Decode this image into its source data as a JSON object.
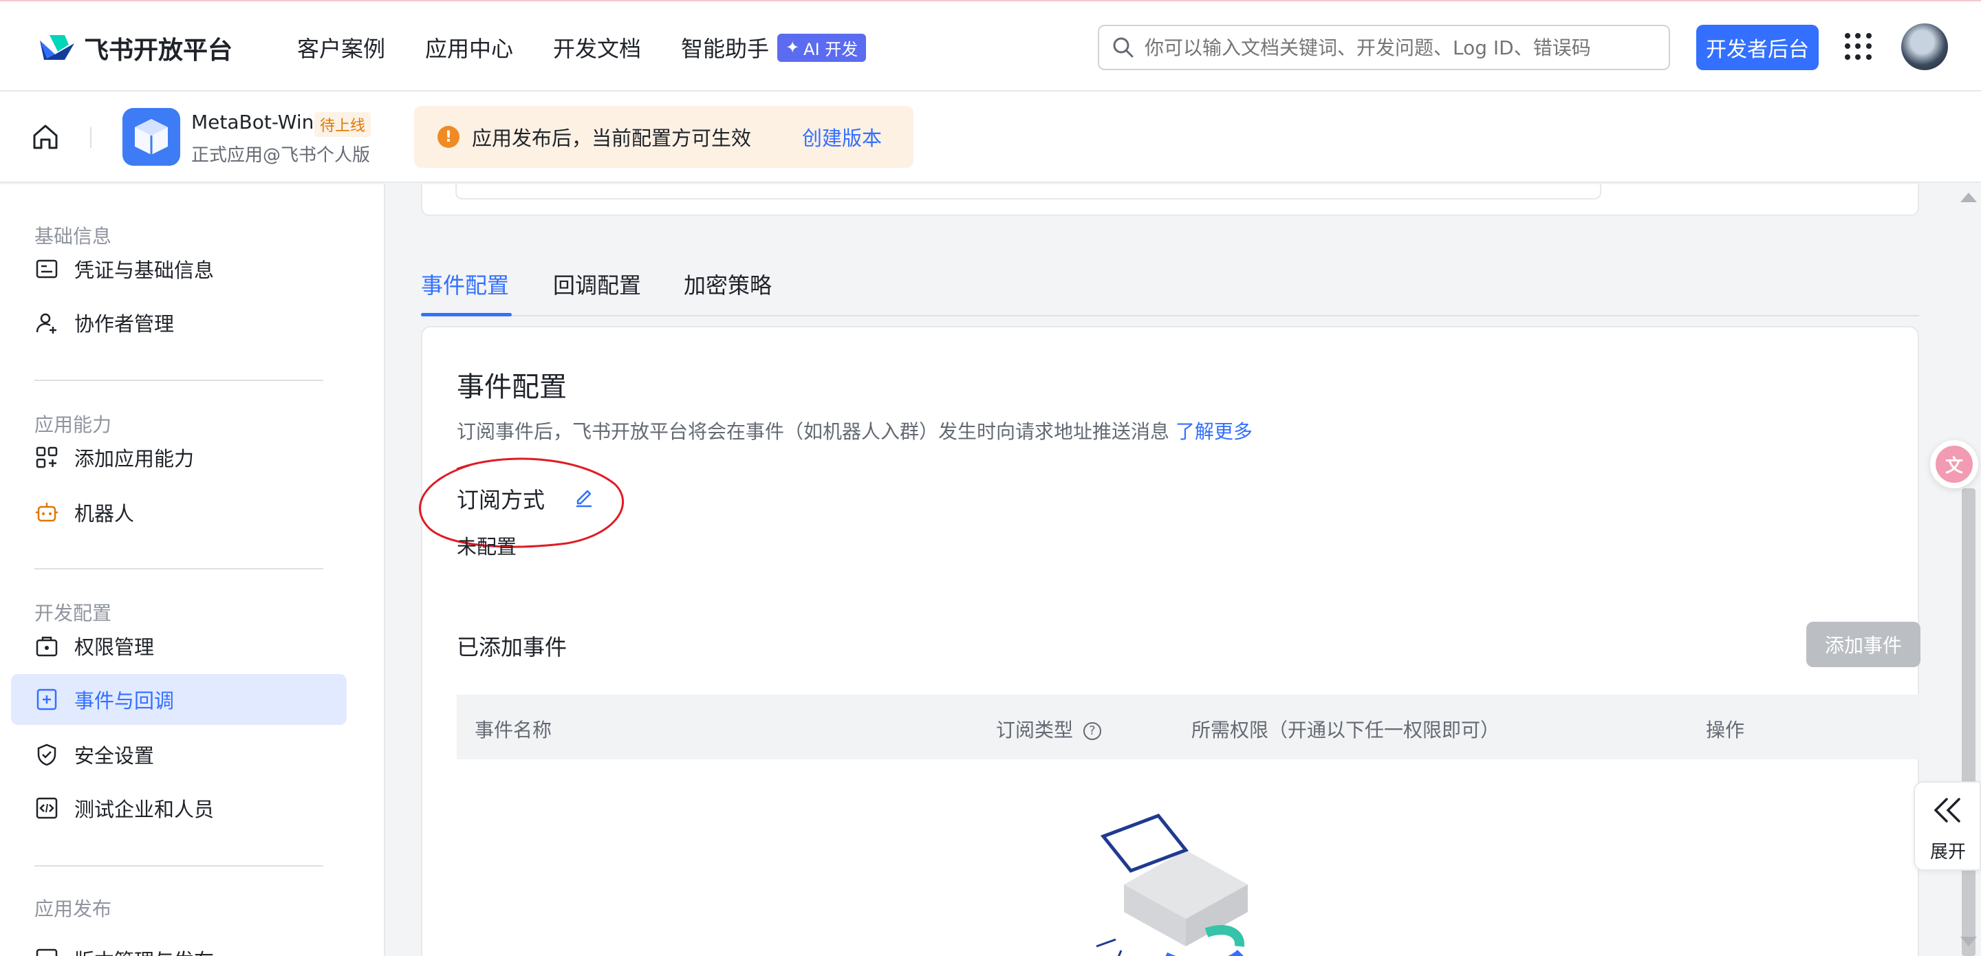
{
  "brand": {
    "name": "飞书开放平台",
    "color": "#3370ff"
  },
  "nav": {
    "items": [
      "客户案例",
      "应用中心",
      "开发文档",
      "智能助手"
    ],
    "ai_badge": "AI 开发"
  },
  "search": {
    "placeholder": "你可以输入文档关键词、开发问题、Log ID、错误码"
  },
  "dev_console_button": "开发者后台",
  "app": {
    "name": "MetaBot-Win",
    "status": "待上线",
    "subtitle": "正式应用@飞书个人版"
  },
  "notice": {
    "text": "应用发布后，当前配置方可生效",
    "link": "创建版本"
  },
  "sidebar": {
    "groups": [
      {
        "label": "基础信息"
      },
      {
        "label": "应用能力"
      },
      {
        "label": "开发配置"
      },
      {
        "label": "应用发布"
      }
    ],
    "items": [
      {
        "label": "凭证与基础信息",
        "icon": "credential-icon"
      },
      {
        "label": "协作者管理",
        "icon": "user-add-icon"
      },
      {
        "label": "添加应用能力",
        "icon": "apps-add-icon"
      },
      {
        "label": "机器人",
        "icon": "robot-icon"
      },
      {
        "label": "权限管理",
        "icon": "permission-icon"
      },
      {
        "label": "事件与回调",
        "icon": "event-icon",
        "active": true
      },
      {
        "label": "安全设置",
        "icon": "shield-icon"
      },
      {
        "label": "测试企业和人员",
        "icon": "test-icon"
      },
      {
        "label": "版本管理与发布",
        "icon": "version-icon"
      }
    ]
  },
  "tabs": [
    "事件配置",
    "回调配置",
    "加密策略"
  ],
  "event_config": {
    "title": "事件配置",
    "description": "订阅事件后，飞书开放平台将会在事件（如机器人入群）发生时向请求地址推送消息",
    "learn_more": "了解更多",
    "subscription_label": "订阅方式",
    "subscription_value": "未配置",
    "added_events_title": "已添加事件",
    "add_event_button": "添加事件",
    "table": {
      "columns": [
        "事件名称",
        "订阅类型",
        "所需权限（开通以下任一权限即可）",
        "操作"
      ]
    }
  },
  "expand_label": "展开"
}
